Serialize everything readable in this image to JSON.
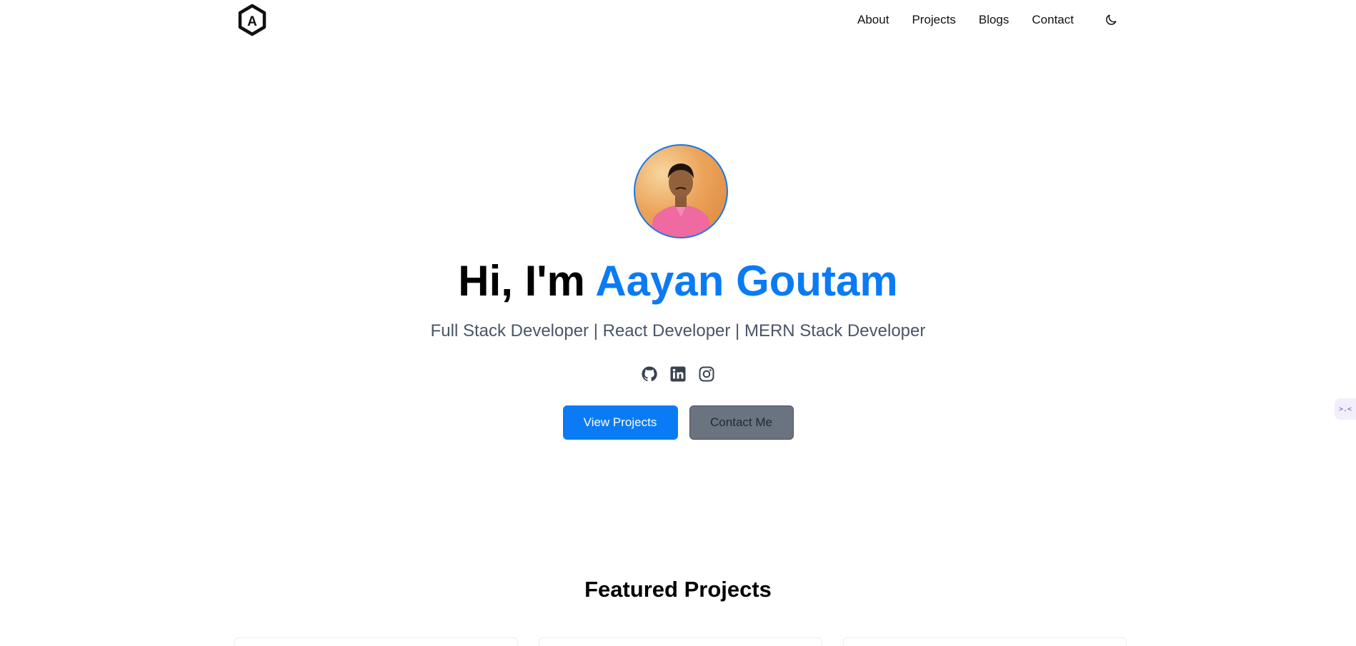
{
  "nav": {
    "logo_icon": "hexagon-letter-a-logo",
    "logo_letter": "A",
    "links": [
      "About",
      "Projects",
      "Blogs",
      "Contact"
    ],
    "theme_icon": "moon-icon"
  },
  "hero": {
    "greeting": "Hi, I'm",
    "name": "Aayan Goutam",
    "subtitle": "Full Stack Developer | React Developer | MERN Stack Developer",
    "avatar_alt": "profile-photo",
    "socials": [
      "github-icon",
      "linkedin-icon",
      "instagram-icon"
    ],
    "primary_button": "View Projects",
    "secondary_button": "Contact Me",
    "accent_color": "#0a7bf5"
  },
  "side_widget": {
    "text": ">.<"
  },
  "featured": {
    "title": "Featured Projects"
  }
}
